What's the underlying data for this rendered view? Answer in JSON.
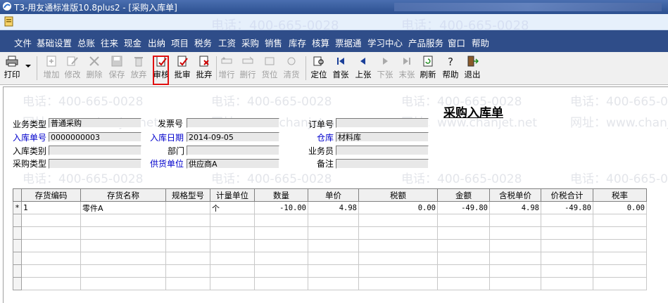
{
  "window": {
    "title": "T3-用友通标准版10.8plus2 - [采购入库单]"
  },
  "menu": [
    "文件",
    "基础设置",
    "总账",
    "往来",
    "现金",
    "出纳",
    "项目",
    "税务",
    "工资",
    "采购",
    "销售",
    "库存",
    "核算",
    "票据通",
    "学习中心",
    "产品服务",
    "窗口",
    "帮助"
  ],
  "toolbar": {
    "print": "打印",
    "add": "增加",
    "modify": "修改",
    "delete": "删除",
    "save": "保存",
    "abandon": "放弃",
    "audit": "审核",
    "batch_audit": "批审",
    "batch_abandon": "批弃",
    "add_row": "增行",
    "delete_row": "删行",
    "stock_pos": "货位",
    "clear": "清货",
    "locate": "定位",
    "first": "首张",
    "prev": "上张",
    "next": "下张",
    "last": "末张",
    "refresh": "刷新",
    "help": "帮助",
    "exit": "退出"
  },
  "watermark": {
    "phone": "电话：400-665-0028",
    "site": "网址：www.chanjet.net"
  },
  "form": {
    "title": "采购入库单",
    "business_type": {
      "label": "业务类型",
      "value": "普通采购"
    },
    "receipt_no": {
      "label": "入库单号",
      "value": "0000000003"
    },
    "receipt_category": {
      "label": "入库类别",
      "value": ""
    },
    "purchase_type": {
      "label": "采购类型",
      "value": ""
    },
    "invoice_no": {
      "label": "发票号",
      "value": ""
    },
    "receipt_date": {
      "label": "入库日期",
      "value": "2014-09-05"
    },
    "department": {
      "label": "部门",
      "value": ""
    },
    "supplier": {
      "label": "供货单位",
      "value": "供应商A"
    },
    "order_no": {
      "label": "订单号",
      "value": ""
    },
    "warehouse": {
      "label": "仓库",
      "value": "材料库"
    },
    "salesperson": {
      "label": "业务员",
      "value": ""
    },
    "remark": {
      "label": "备注",
      "value": ""
    }
  },
  "grid": {
    "columns": [
      "存货编码",
      "存货名称",
      "规格型号",
      "计量单位",
      "数量",
      "单价",
      "税额",
      "金额",
      "含税单价",
      "价税合计",
      "税率"
    ],
    "rows": [
      {
        "marker": "*",
        "code": "1",
        "name": "零件A",
        "spec": "",
        "unit": "个",
        "qty": "-10.00",
        "price": "4.98",
        "tax": "0.00",
        "amount": "-49.80",
        "tax_price": "4.98",
        "total": "-49.80",
        "rate": "0.00"
      }
    ]
  },
  "colors": {
    "menubar": "#2f4d89",
    "titlebar": "#2b4f8f",
    "highlight": "#e01010",
    "label_blue": "#0000cc"
  }
}
